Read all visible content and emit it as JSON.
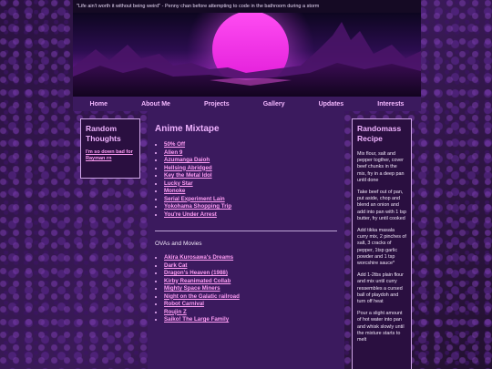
{
  "header": {
    "quote": "\"Life ain't worth it without being weird\" - Penny chan before attempting to code in the bathroom during a storm"
  },
  "nav": {
    "items": [
      "Home",
      "About Me",
      "Projects",
      "Gallery",
      "Updates",
      "Interests"
    ]
  },
  "left_sidebar": {
    "title": "Random Thoughts",
    "link": "I'm so down bad for Rayman rn"
  },
  "main": {
    "title": "Anime Mixtape",
    "anime": [
      "50% Off",
      "Alien 9",
      "Azumanga Daioh",
      "Hellsing Abridged",
      "Key the Metal Idol",
      "Lucky Star",
      "Monoke",
      "Serial Experiment Lain",
      "Yokohama Shopping Trip",
      "You're Under Arrest"
    ],
    "ova_heading": "OVAs and Movies",
    "ovas": [
      "Akira Kurosawa's Dreams",
      "Dark Cat",
      "Dragon's Heaven (1988)",
      "Kirby Reanimated Collab",
      "Mighty Space Miners",
      "Night on the Galatic railroad",
      "Robot Carnival",
      "Roujin Z",
      "Saiko! The Large Family"
    ]
  },
  "right_sidebar": {
    "title": "Randomass Recipe",
    "steps": [
      "Mix flour, salt and pepper togther, cover beef chunks in the mix, fry in a deep pan until done",
      "Take beef out of pan, put aside, chop and blend an onion and add into pan with 1 tsp butter, fry until cooked",
      "Add tikka masala curry mix, 2 pinches of salt, 3 cracks of pepper, 1tsp garlic powder and 1 tsp worcshire sauce*",
      "Add 1-2tbs plain flour and mix until curry ressembles a cursed ball of playdoh and turn off heat",
      "Pour a slight amount of hot water into pan and whisk slowly until the mixture starts to melt"
    ]
  },
  "colors": {
    "accent": "#f0b3ff",
    "link": "#ff9df5",
    "panel": "#3b1a5e",
    "sidebar": "#2a0f40",
    "background": "#241033"
  }
}
